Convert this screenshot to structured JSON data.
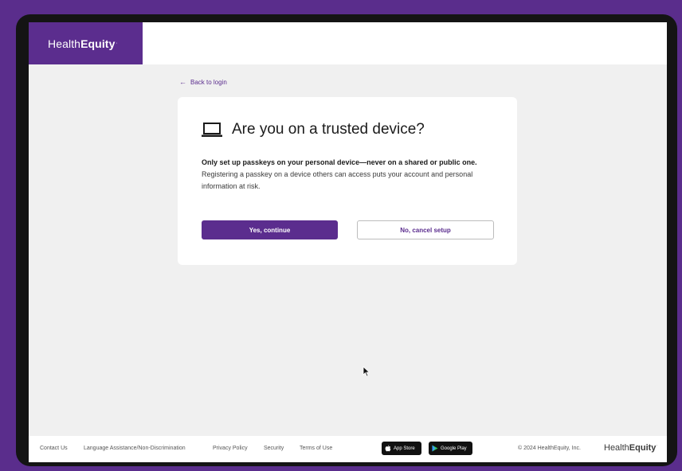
{
  "header": {
    "logo_regular": "Health",
    "logo_bold": "Equity",
    "logo_mark": "·"
  },
  "back_link": {
    "arrow": "←",
    "label": "Back to login"
  },
  "dialog": {
    "icon": "laptop-icon",
    "title": "Are you on a trusted device?",
    "body_strong": "Only set up passkeys on your personal device—never on a shared or public one.",
    "body_rest": " Registering a passkey on a device others can access puts your account and personal information at risk.",
    "primary_button": "Yes, continue",
    "secondary_button": "No, cancel setup"
  },
  "footer": {
    "links": [
      "Contact Us",
      "Language Assistance/Non-Discrimination",
      "Privacy Policy",
      "Security",
      "Terms of Use"
    ],
    "app_store_label": "App Store",
    "google_play_label": "Google Play",
    "copyright": "© 2024 HealthEquity, Inc.",
    "logo_regular": "Health",
    "logo_bold": "Equity",
    "logo_mark": "·"
  },
  "colors": {
    "brand_purple": "#5b2d8e",
    "page_background": "#f0f0f0",
    "outer_background": "#5a2d8c"
  }
}
